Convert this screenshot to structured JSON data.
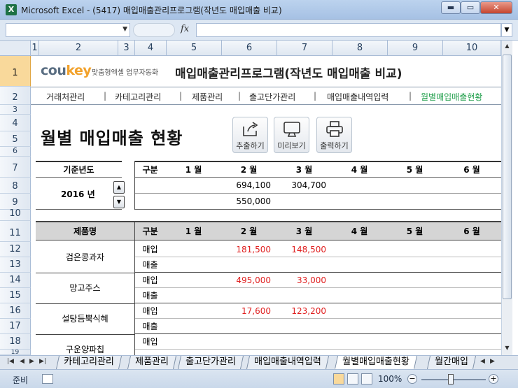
{
  "window": {
    "title": "Microsoft Excel - (5417) 매입매출관리프로그램(작년도 매입매출 비교)",
    "minimize": "▬",
    "maximize": "▭",
    "close": "✕"
  },
  "formula_bar": {
    "name_box": "",
    "fx_label": "fx",
    "content": ""
  },
  "columns": [
    "1",
    "2",
    "3",
    "4",
    "5",
    "6",
    "7",
    "8",
    "9",
    "10"
  ],
  "rows": [
    "1",
    "2",
    "3",
    "4",
    "5",
    "6",
    "7",
    "8",
    "9",
    "10",
    "11",
    "12",
    "13",
    "14",
    "15",
    "16",
    "17",
    "18",
    "19"
  ],
  "header": {
    "logo_main": "cou",
    "logo_accent": "key",
    "logo_sub": "맞춤형엑셀 업무자동화",
    "app_title": "매입매출관리프로그램(작년도 매입매출 비교)"
  },
  "nav": {
    "items": [
      {
        "label": "거래처관리"
      },
      {
        "label": "카테고리관리"
      },
      {
        "label": "제품관리"
      },
      {
        "label": "출고단가관리"
      },
      {
        "label": "매입매출내역입력"
      },
      {
        "label": "월별매입매출현황"
      }
    ],
    "separator": "|"
  },
  "page_title": "월별 매입매출 현황",
  "toolbar": {
    "extract_label": "추출하기",
    "preview_label": "미리보기",
    "print_label": "출력하기"
  },
  "summary": {
    "year_header": "기준년도",
    "year_value": "2016 년",
    "spin_up": "▲",
    "spin_down": "▼",
    "columns": [
      "구분",
      "1 월",
      "2 월",
      "3 월",
      "4 월",
      "5 월",
      "6 월"
    ],
    "rows": [
      {
        "values": [
          "",
          "",
          "694,100",
          "304,700",
          "",
          "",
          ""
        ]
      },
      {
        "values": [
          "",
          "",
          "550,000",
          "",
          "",
          "",
          ""
        ]
      }
    ]
  },
  "main_table": {
    "columns": [
      "제품명",
      "구분",
      "1 월",
      "2 월",
      "3 월",
      "4 월",
      "5 월",
      "6 월"
    ],
    "products": [
      {
        "name": "검은콩과자",
        "buy_label": "매입",
        "sell_label": "매출",
        "buy": [
          "",
          "181,500",
          "148,500",
          "",
          "",
          ""
        ],
        "sell": [
          "",
          "",
          "",
          "",
          "",
          ""
        ]
      },
      {
        "name": "망고주스",
        "buy_label": "매입",
        "sell_label": "매출",
        "buy": [
          "",
          "495,000",
          "33,000",
          "",
          "",
          ""
        ],
        "sell": [
          "",
          "",
          "",
          "",
          "",
          ""
        ]
      },
      {
        "name": "설탕듬뿍식혜",
        "buy_label": "매입",
        "sell_label": "매출",
        "buy": [
          "",
          "17,600",
          "123,200",
          "",
          "",
          ""
        ],
        "sell": [
          "",
          "",
          "",
          "",
          "",
          ""
        ]
      },
      {
        "name": "구운양파칩",
        "buy_label": "매입",
        "sell_label": "",
        "buy": [
          "",
          "",
          "",
          "",
          "",
          ""
        ],
        "sell": [
          "",
          "",
          "",
          "",
          "",
          ""
        ]
      }
    ]
  },
  "sheet_tabs": {
    "nav": [
      "|◀",
      "◀",
      "▶",
      "▶|"
    ],
    "tabs": [
      "카테고리관리",
      "제품관리",
      "출고단가관리",
      "매입매출내역입력",
      "월별매입매출현황",
      "월간매입"
    ],
    "active_index": 4
  },
  "status": {
    "ready": "준비",
    "zoom": "100%",
    "zoom_minus": "−",
    "zoom_plus": "+"
  }
}
